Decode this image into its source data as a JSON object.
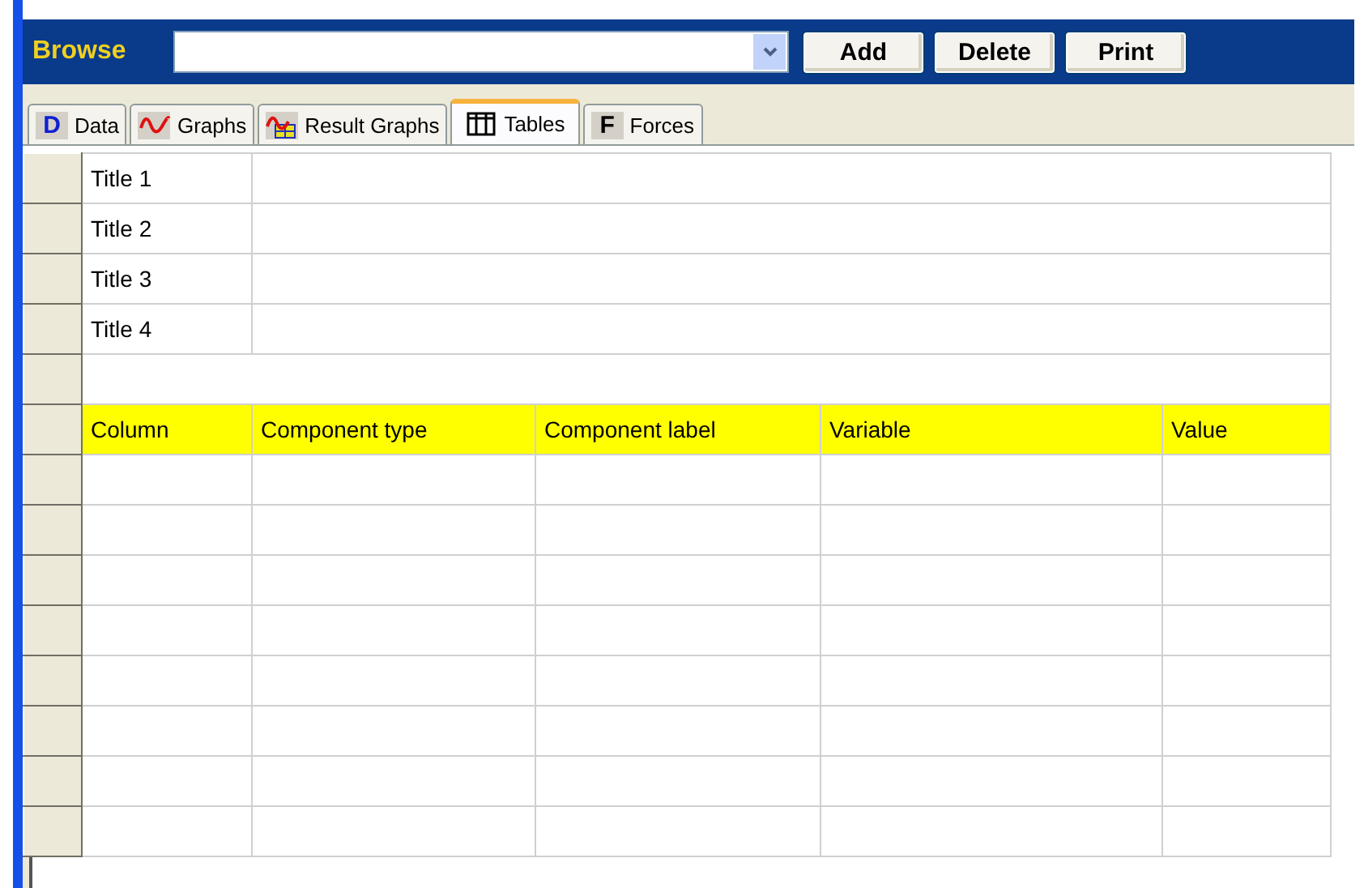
{
  "toolbar": {
    "label": "Browse",
    "buttons": [
      "Add",
      "Delete",
      "Print"
    ]
  },
  "tabs": [
    {
      "label": "Data",
      "kind": "letter",
      "glyph": "D",
      "selected": false
    },
    {
      "label": "Graphs",
      "kind": "wave",
      "selected": false
    },
    {
      "label": "Result Graphs",
      "kind": "result",
      "selected": false
    },
    {
      "label": "Tables",
      "kind": "grid",
      "selected": true
    },
    {
      "label": "Forces",
      "kind": "letter",
      "glyph": "F",
      "selected": false
    }
  ],
  "titles": [
    "Title 1",
    "Title 2",
    "Title 3",
    "Title 4"
  ],
  "table": {
    "columns": [
      "Column",
      "Component type",
      "Component label",
      "Variable",
      "Value"
    ]
  }
}
